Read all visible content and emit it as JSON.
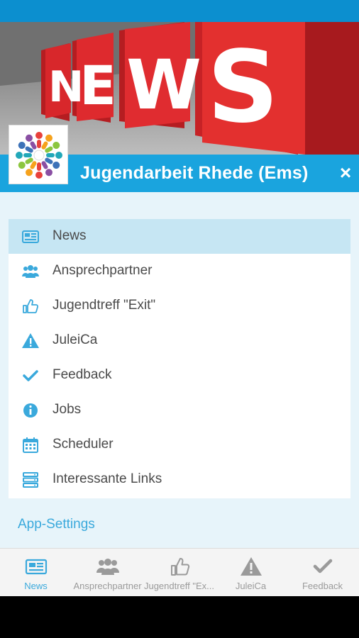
{
  "hero": {
    "letters": [
      "N",
      "E",
      "W",
      "S"
    ]
  },
  "header": {
    "title": "Jugendarbeit Rhede (Ems)",
    "close_glyph": "×"
  },
  "menu": {
    "items": [
      {
        "label": "News",
        "icon": "newspaper-icon",
        "active": true
      },
      {
        "label": "Ansprechpartner",
        "icon": "users-icon",
        "active": false
      },
      {
        "label": "Jugendtreff \"Exit\"",
        "icon": "thumbs-up-icon",
        "active": false
      },
      {
        "label": "JuleiCa",
        "icon": "warning-icon",
        "active": false
      },
      {
        "label": "Feedback",
        "icon": "check-icon",
        "active": false
      },
      {
        "label": "Jobs",
        "icon": "info-icon",
        "active": false
      },
      {
        "label": "Scheduler",
        "icon": "calendar-icon",
        "active": false
      },
      {
        "label": "Interessante Links",
        "icon": "server-icon",
        "active": false
      }
    ],
    "settings_label": "App-Settings"
  },
  "tabbar": {
    "tabs": [
      {
        "label": "News",
        "icon": "newspaper-icon",
        "active": true
      },
      {
        "label": "Ansprechpartner",
        "icon": "users-icon",
        "active": false
      },
      {
        "label": "Jugendtreff \"Ex...",
        "icon": "thumbs-up-icon",
        "active": false
      },
      {
        "label": "JuleiCa",
        "icon": "warning-icon",
        "active": false
      },
      {
        "label": "Feedback",
        "icon": "check-icon",
        "active": false
      }
    ]
  },
  "colors": {
    "status_bar": "#0c8fcf",
    "header_bar": "#1aa4de",
    "accent": "#3aa9dc",
    "drawer_bg": "#e7f4fa",
    "active_item": "#c6e6f3",
    "hero_red": "#d8272b"
  }
}
